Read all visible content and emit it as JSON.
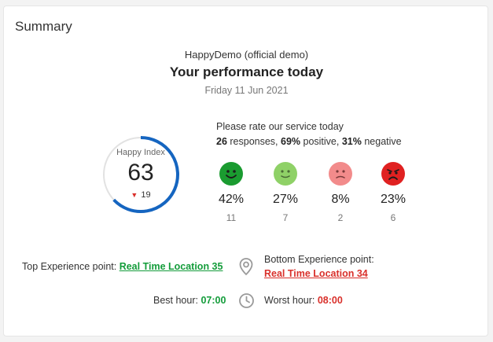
{
  "card": {
    "title": "Summary",
    "company": "HappyDemo (official demo)",
    "heading": "Your performance today",
    "date": "Friday 11 Jun 2021"
  },
  "happy_index": {
    "label": "Happy Index",
    "value": "63",
    "change": "19",
    "change_direction": "down",
    "gauge_fraction": 0.63,
    "arc_color": "#1565c0"
  },
  "rating": {
    "prompt": "Please rate our service today",
    "responses": "26",
    "responses_suffix": " responses, ",
    "positive": "69%",
    "positive_suffix": " positive, ",
    "negative": "31%",
    "negative_suffix": " negative",
    "levels": [
      {
        "icon": "very-happy-face-icon",
        "color": "#1a9b30",
        "percent": "42%",
        "count": "11"
      },
      {
        "icon": "happy-face-icon",
        "color": "#8fd167",
        "percent": "27%",
        "count": "7"
      },
      {
        "icon": "sad-face-icon",
        "color": "#f28b8b",
        "percent": "8%",
        "count": "2"
      },
      {
        "icon": "very-sad-face-icon",
        "color": "#e02121",
        "percent": "23%",
        "count": "6"
      }
    ]
  },
  "experience": {
    "top_label": "Top Experience point: ",
    "top_link": "Real Time Location 35",
    "bottom_label": "Bottom Experience point:",
    "bottom_link": "Real Time Location 34",
    "location_icon": "map-pin-icon"
  },
  "hours": {
    "best_label": "Best hour: ",
    "best_value": "07:00",
    "worst_label": "Worst hour: ",
    "worst_value": "08:00",
    "clock_icon": "clock-icon"
  }
}
